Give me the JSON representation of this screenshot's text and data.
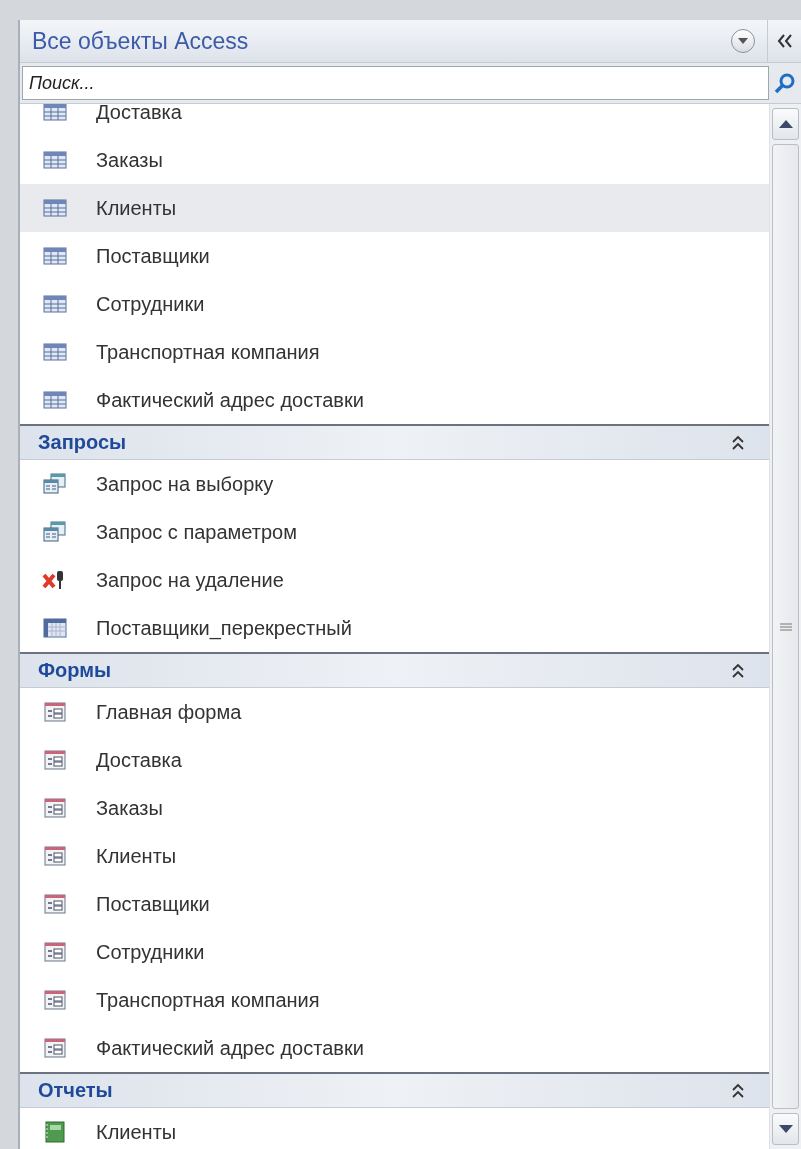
{
  "pane": {
    "title": "Все объекты Access",
    "search": {
      "placeholder": "Поиск..."
    }
  },
  "sections": [
    {
      "items": [
        {
          "label": "Доставка",
          "kind": "table",
          "selected": false
        },
        {
          "label": "Заказы",
          "kind": "table",
          "selected": false
        },
        {
          "label": "Клиенты",
          "kind": "table",
          "selected": true
        },
        {
          "label": "Поставщики",
          "kind": "table",
          "selected": false
        },
        {
          "label": "Сотрудники",
          "kind": "table",
          "selected": false
        },
        {
          "label": "Транспортная компания",
          "kind": "table",
          "selected": false
        },
        {
          "label": "Фактический адрес доставки",
          "kind": "table",
          "selected": false
        }
      ]
    },
    {
      "title": "Запросы",
      "expanded": true,
      "items": [
        {
          "label": "Запрос на выборку",
          "kind": "select_query",
          "selected": false
        },
        {
          "label": "Запрос с параметром",
          "kind": "select_query",
          "selected": false
        },
        {
          "label": "Запрос на удаление",
          "kind": "delete_query",
          "selected": false
        },
        {
          "label": "Поставщики_перекрестный",
          "kind": "crosstab_query",
          "selected": false
        }
      ]
    },
    {
      "title": "Формы",
      "expanded": true,
      "items": [
        {
          "label": "Главная форма",
          "kind": "form",
          "selected": false
        },
        {
          "label": "Доставка",
          "kind": "form",
          "selected": false
        },
        {
          "label": "Заказы",
          "kind": "form",
          "selected": false
        },
        {
          "label": "Клиенты",
          "kind": "form",
          "selected": false
        },
        {
          "label": "Поставщики",
          "kind": "form",
          "selected": false
        },
        {
          "label": "Сотрудники",
          "kind": "form",
          "selected": false
        },
        {
          "label": "Транспортная компания",
          "kind": "form",
          "selected": false
        },
        {
          "label": "Фактический адрес доставки",
          "kind": "form",
          "selected": false
        }
      ]
    },
    {
      "title": "Отчеты",
      "expanded": true,
      "items": [
        {
          "label": "Клиенты",
          "kind": "report",
          "selected": false
        }
      ]
    }
  ]
}
